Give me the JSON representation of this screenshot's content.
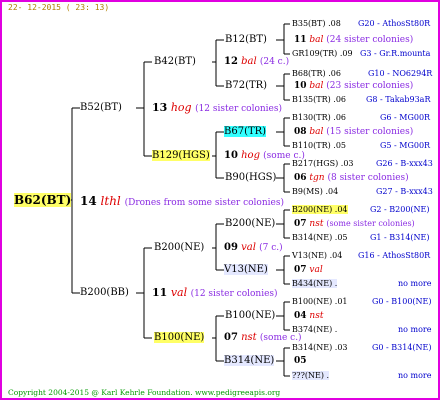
{
  "date": "22- 12-2015 ( 23: 13)",
  "copyright": "Copyright 2004-2015 @ Karl Kehrle Foundation.   www.pedigreeapis.org",
  "root": {
    "id": "B62(BT)",
    "num": "14",
    "sub": "lthl",
    "note": "(Drones from some sister colonies)"
  },
  "g1": [
    {
      "id": "B52(BT)",
      "num": "13",
      "sub": "hog",
      "note": "(12 sister colonies)"
    },
    {
      "id": "B200(BB)",
      "num": "11",
      "sub": "val",
      "note": "(12 sister colonies)"
    }
  ],
  "g2": [
    {
      "id": "B42(BT)",
      "num": "12",
      "sub": "bal",
      "note": "(24 c.)"
    },
    {
      "id": "B129(HGS)",
      "num": "10",
      "sub": "hog",
      "note": "(some c.)"
    },
    {
      "id": "B200(NE)",
      "num": "09",
      "sub": "val",
      "note": "(7 c.)"
    },
    {
      "id": "B100(NE)",
      "num": "07",
      "sub": "nst",
      "note": "(some c.)"
    }
  ],
  "g3": [
    {
      "id": "B12(BT)",
      "num": "11",
      "sub": "bal",
      "note": "(24 sister colonies)"
    },
    {
      "id": "B72(TR)",
      "num": "10",
      "sub": "bal",
      "note": "(23 sister colonies)"
    },
    {
      "id": "B67(TR)",
      "num": "08",
      "sub": "bal",
      "note": "(15 sister colonies)"
    },
    {
      "id": "B90(HGS)",
      "num": "06",
      "sub": "tgn",
      "note": "(8 sister colonies)"
    },
    {
      "id": "B200(NE)",
      "num": "07",
      "sub": "nst",
      "note": "(some sister colonies)"
    },
    {
      "id": "V13(NE)",
      "num": "07",
      "sub": "val",
      "note": ""
    },
    {
      "id": "B100(NE)",
      "num": "04",
      "sub": "nst",
      "note": ""
    },
    {
      "id": "B314(NE)",
      "num": "05",
      "sub": "",
      "note": ""
    }
  ],
  "g4": [
    {
      "id": "B35(BT)",
      "n": ".08",
      "info": "G20 - AthosSt80R"
    },
    {
      "id": "GR109(TR)",
      "n": ".09",
      "info": "G3 - Gr.R.mounta"
    },
    {
      "id": "B68(TR)",
      "n": ".06",
      "info": "G10 - NO6294R"
    },
    {
      "id": "B135(TR)",
      "n": ".06",
      "info": "G8 - Takab93aR"
    },
    {
      "id": "B130(TR)",
      "n": ".06",
      "info": "G6 - MG00R"
    },
    {
      "id": "B110(TR)",
      "n": ".05",
      "info": "G5 - MG00R"
    },
    {
      "id": "B217(HGS)",
      "n": ".03",
      "info": "G26 - B-xxx43"
    },
    {
      "id": "B9(MS)",
      "n": ".04",
      "info": "G27 - B-xxx43"
    },
    {
      "id": "B200(NE)",
      "n": ".04",
      "info": "G2 - B200(NE)"
    },
    {
      "id": "B314(NE)",
      "n": ".05",
      "info": "G1 - B314(NE)"
    },
    {
      "id": "V13(NE)",
      "n": ".04",
      "info": "G16 - AthosSt80R"
    },
    {
      "id": "B434(NE)",
      "n": ".",
      "info": "no more"
    },
    {
      "id": "B100(NE)",
      "n": ".01",
      "info": "G0 - B100(NE)"
    },
    {
      "id": "B374(NE)",
      "n": ".",
      "info": "no more"
    },
    {
      "id": "B314(NE)",
      "n": ".03",
      "info": "G0 - B314(NE)"
    },
    {
      "id": "???(NE)",
      "n": ".",
      "info": "no more"
    }
  ]
}
